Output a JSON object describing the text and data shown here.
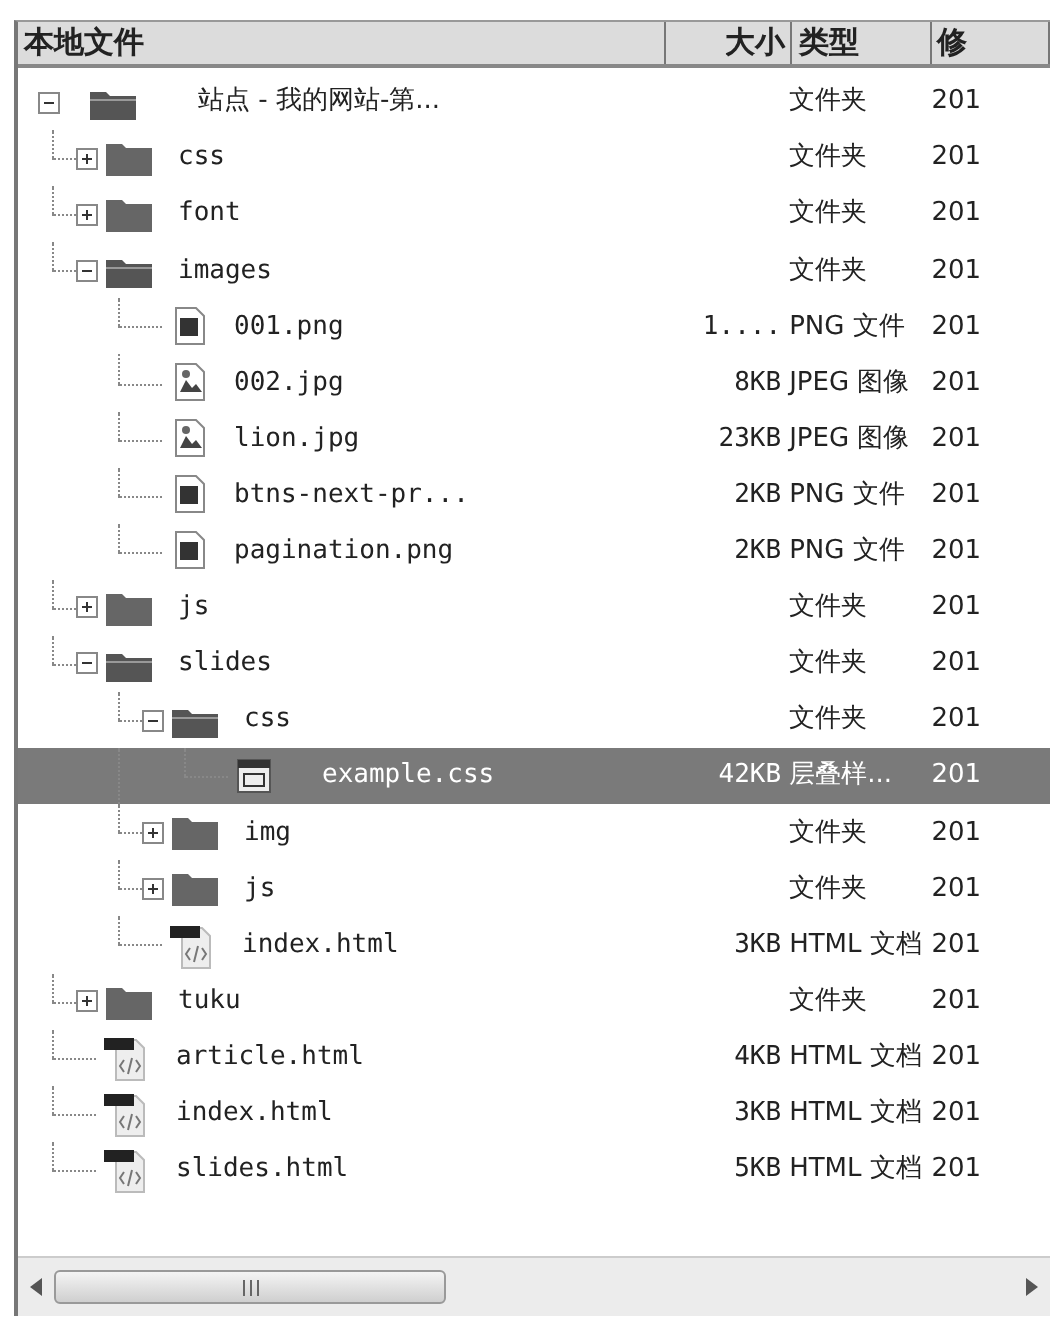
{
  "columns": [
    {
      "label": "本地文件"
    },
    {
      "label": "大小"
    },
    {
      "label": "类型"
    },
    {
      "label": "修"
    }
  ],
  "tree": [
    {
      "name": "站点 - 我的网站-第...",
      "type": "文件夹",
      "date": "201",
      "kind": "site",
      "expanded": true,
      "selected": false,
      "children": [
        {
          "name": "css",
          "type": "文件夹",
          "date": "201",
          "kind": "folder",
          "expanded": false,
          "selected": false
        },
        {
          "name": "font",
          "type": "文件夹",
          "date": "201",
          "kind": "folder",
          "expanded": false,
          "selected": false
        },
        {
          "name": "images",
          "type": "文件夹",
          "date": "201",
          "kind": "folder",
          "expanded": true,
          "selected": false,
          "children": [
            {
              "name": "001.png",
              "size": "1....",
              "type": "PNG 文件",
              "date": "201",
              "kind": "png",
              "selected": false
            },
            {
              "name": "002.jpg",
              "size": "8KB",
              "type": "JPEG 图像",
              "date": "201",
              "kind": "jpg",
              "selected": false
            },
            {
              "name": "lion.jpg",
              "size": "23KB",
              "type": "JPEG 图像",
              "date": "201",
              "kind": "jpg",
              "selected": false
            },
            {
              "name": "btns-next-pr...",
              "size": "2KB",
              "type": "PNG 文件",
              "date": "201",
              "kind": "png",
              "selected": false
            },
            {
              "name": "pagination.png",
              "size": "2KB",
              "type": "PNG 文件",
              "date": "201",
              "kind": "png",
              "selected": false
            }
          ]
        },
        {
          "name": "js",
          "type": "文件夹",
          "date": "201",
          "kind": "folder",
          "expanded": false,
          "selected": false
        },
        {
          "name": "slides",
          "type": "文件夹",
          "date": "201",
          "kind": "folder",
          "expanded": true,
          "selected": false,
          "children": [
            {
              "name": "css",
              "type": "文件夹",
              "date": "201",
              "kind": "folder",
              "expanded": true,
              "selected": false,
              "children": [
                {
                  "name": "example.css",
                  "size": "42KB",
                  "type": "层叠样...",
                  "date": "201",
                  "kind": "css",
                  "selected": true
                }
              ]
            },
            {
              "name": "img",
              "type": "文件夹",
              "date": "201",
              "kind": "folder",
              "expanded": false,
              "selected": false
            },
            {
              "name": "js",
              "type": "文件夹",
              "date": "201",
              "kind": "folder",
              "expanded": false,
              "selected": false
            },
            {
              "name": "index.html",
              "size": "3KB",
              "type": "HTML 文档",
              "date": "201",
              "kind": "html",
              "selected": false
            }
          ]
        },
        {
          "name": "tuku",
          "type": "文件夹",
          "date": "201",
          "kind": "folder",
          "expanded": false,
          "selected": false
        },
        {
          "name": "article.html",
          "size": "4KB",
          "type": "HTML 文档",
          "date": "201",
          "kind": "html",
          "selected": false
        },
        {
          "name": "index.html",
          "size": "3KB",
          "type": "HTML 文档",
          "date": "201",
          "kind": "html",
          "selected": false
        },
        {
          "name": "slides.html",
          "size": "5KB",
          "type": "HTML 文档",
          "date": "201",
          "kind": "html",
          "selected": false
        }
      ]
    }
  ]
}
